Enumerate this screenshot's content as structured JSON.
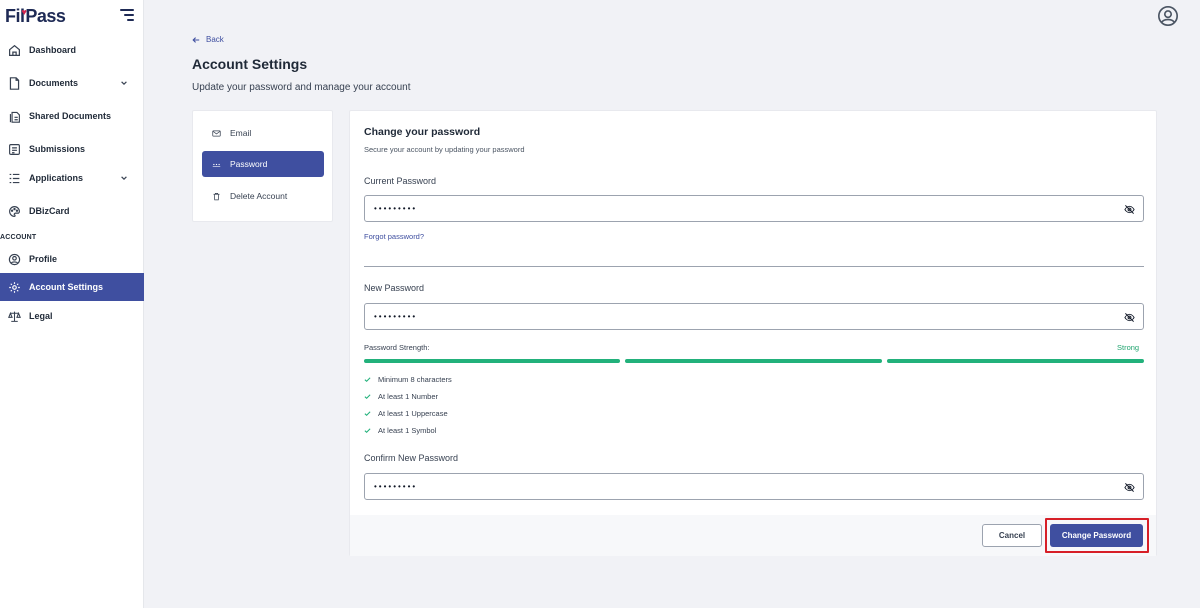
{
  "app": {
    "logo_text_1": "Fil",
    "logo_text_2": "ass"
  },
  "sidebar": {
    "items": [
      {
        "label": "Dashboard",
        "icon": "home-icon"
      },
      {
        "label": "Documents",
        "icon": "document-icon"
      },
      {
        "label": "Shared Documents",
        "icon": "shared-documents-icon"
      },
      {
        "label": "Submissions",
        "icon": "submissions-icon"
      },
      {
        "label": "Applications",
        "icon": "list-icon"
      },
      {
        "label": "DBizCard",
        "icon": "palette-icon"
      }
    ],
    "section_label": "ACCOUNT",
    "account_items": [
      {
        "label": "Profile",
        "icon": "user-circle-icon"
      },
      {
        "label": "Account Settings",
        "icon": "gear-icon",
        "active": true
      },
      {
        "label": "Legal",
        "icon": "scale-icon"
      }
    ]
  },
  "header": {
    "back_label": "Back",
    "title": "Account Settings",
    "subtitle": "Update your password and manage your account"
  },
  "settings_menu": {
    "items": [
      {
        "label": "Email",
        "icon": "mail-icon"
      },
      {
        "label": "Password",
        "icon": "password-icon",
        "active": true
      },
      {
        "label": "Delete Account",
        "icon": "trash-icon"
      }
    ]
  },
  "form": {
    "title": "Change your password",
    "subtitle": "Secure your account by updating your password",
    "current_password_label": "Current Password",
    "current_password_value": "•••••••••",
    "forgot_link": "Forgot password?",
    "new_password_label": "New Password",
    "new_password_value": "•••••••••",
    "strength_label": "Password Strength:",
    "strength_value": "Strong",
    "strength_fill": 1.0,
    "requirements": [
      "Minimum 8 characters",
      "At least 1 Number",
      "At least 1 Uppercase",
      "At least 1 Symbol"
    ],
    "confirm_password_label": "Confirm New Password",
    "confirm_password_value": "•••••••••",
    "cancel_label": "Cancel",
    "submit_label": "Change Password"
  },
  "colors": {
    "primary": "#3f4fa0",
    "success": "#22b17b",
    "highlight": "#d71f27"
  }
}
